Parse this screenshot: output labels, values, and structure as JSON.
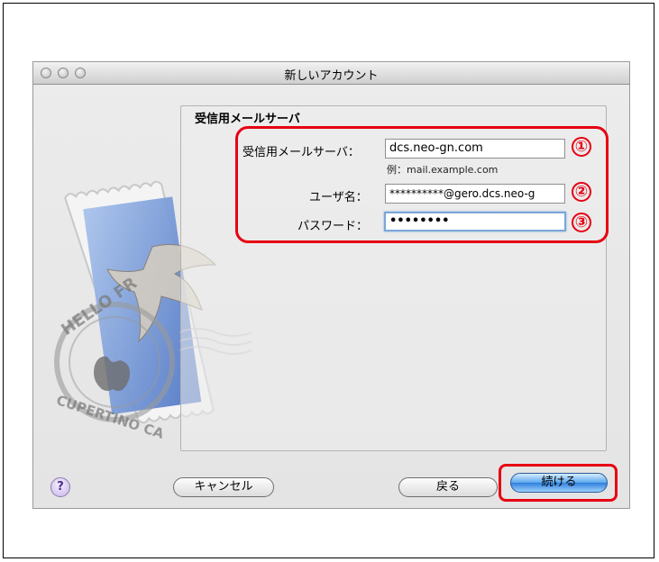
{
  "window": {
    "title": "新しいアカウント"
  },
  "form": {
    "section_title": "受信用メールサーバ",
    "incoming_server": {
      "label": "受信用メールサーバ：",
      "value": "dcs.neo-gn.com",
      "hint": "例：mail.example.com"
    },
    "user_name": {
      "label": "ユーザ名：",
      "value": "**********@gero.dcs.neo-g"
    },
    "password": {
      "label": "パスワード：",
      "value": "••••••••"
    }
  },
  "markers": [
    "①",
    "②",
    "③"
  ],
  "buttons": {
    "help": "?",
    "cancel": "キャンセル",
    "back": "戻る",
    "continue": "続ける"
  },
  "stamp_text": {
    "top": "HELLO FR",
    "bottom": "CUPERTINO CA"
  },
  "colors": {
    "callout": "#e60012",
    "primary_button": "#3b8ce6"
  }
}
